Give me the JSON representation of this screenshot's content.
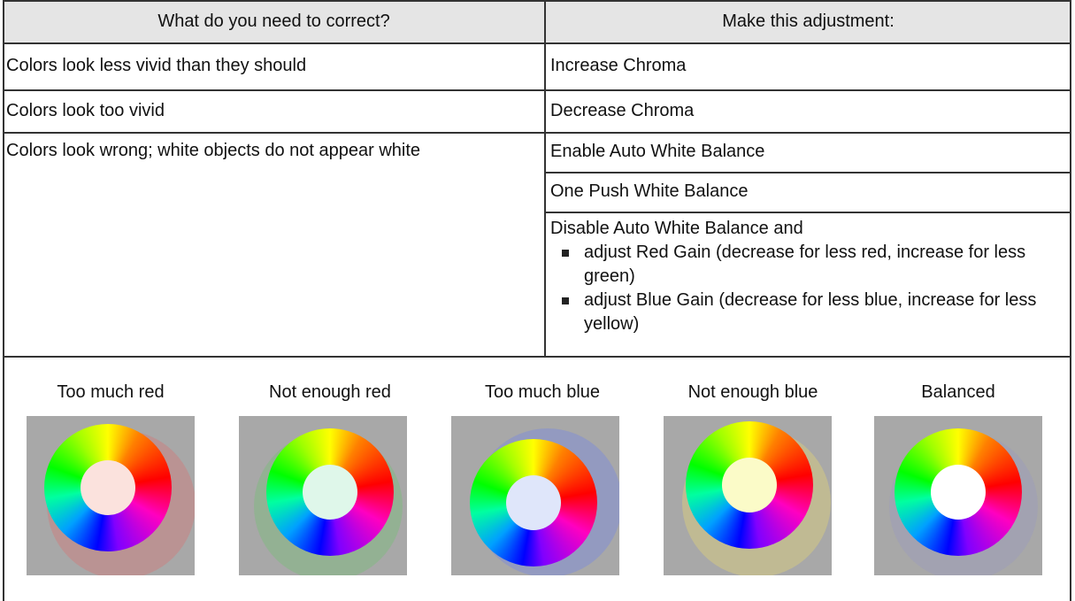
{
  "table": {
    "headers": {
      "left": "What do you need to correct?",
      "right": "Make this adjustment:"
    },
    "rows": [
      {
        "problem": "Colors look less vivid than they should",
        "adjustment": "Increase Chroma"
      },
      {
        "problem": "Colors look too vivid",
        "adjustment": "Decrease Chroma"
      }
    ],
    "white_row": {
      "problem": "Colors look wrong; white objects do not appear white",
      "adjustments": [
        "Enable Auto White Balance",
        "One Push White Balance"
      ],
      "manual": {
        "intro": "Disable Auto White Balance and",
        "items": [
          "adjust Red Gain (decrease for less red, increase for less green)",
          "adjust Blue Gain (decrease for less blue, increase for less yellow)"
        ]
      }
    }
  },
  "color_wheels": [
    {
      "label": "Too much red",
      "center_color": "#fbe2dd",
      "tint": "#c08c8c"
    },
    {
      "label": "Not enough red",
      "center_color": "#dff7ea",
      "tint": "#8cb48c"
    },
    {
      "label": "Too much blue",
      "center_color": "#dfe6fa",
      "tint": "#8c96c8"
    },
    {
      "label": "Not enough blue",
      "center_color": "#fbfbc8",
      "tint": "#c8c08c"
    },
    {
      "label": "Balanced",
      "center_color": "#ffffff",
      "tint": "#a0a0b4"
    }
  ]
}
